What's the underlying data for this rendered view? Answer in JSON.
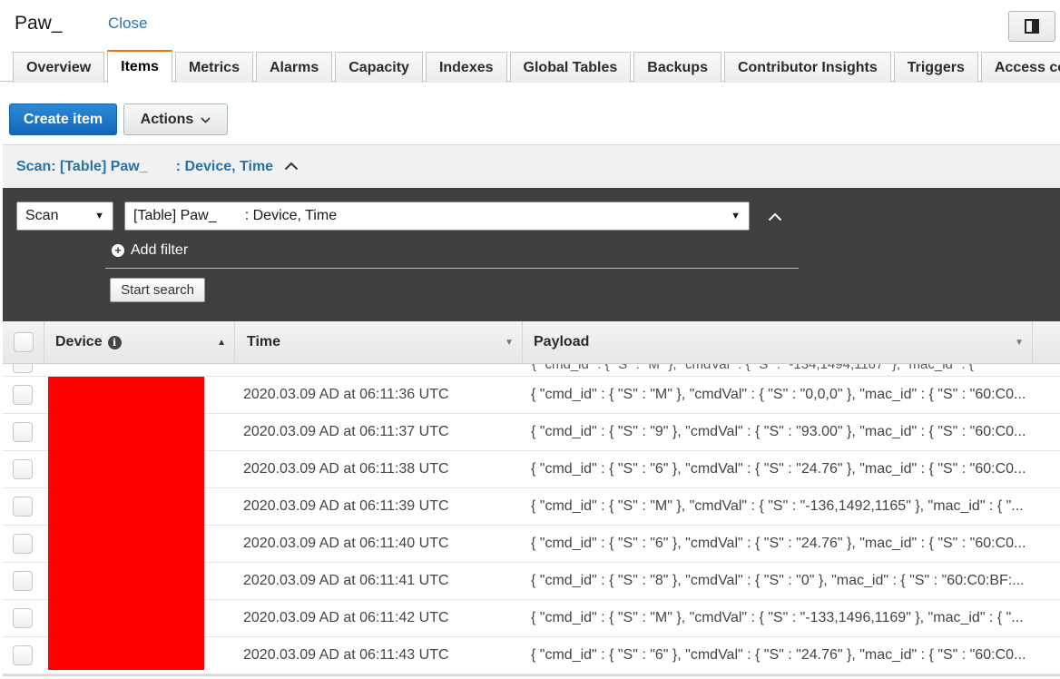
{
  "header": {
    "title": "Paw_",
    "close_label": "Close"
  },
  "tabs": [
    {
      "label": "Overview",
      "active": false
    },
    {
      "label": "Items",
      "active": true
    },
    {
      "label": "Metrics",
      "active": false
    },
    {
      "label": "Alarms",
      "active": false
    },
    {
      "label": "Capacity",
      "active": false
    },
    {
      "label": "Indexes",
      "active": false
    },
    {
      "label": "Global Tables",
      "active": false
    },
    {
      "label": "Backups",
      "active": false
    },
    {
      "label": "Contributor Insights",
      "active": false
    },
    {
      "label": "Triggers",
      "active": false
    },
    {
      "label": "Access contro",
      "active": false
    }
  ],
  "toolbar": {
    "create_item_label": "Create item",
    "actions_label": "Actions"
  },
  "scan": {
    "header_label": "Scan: [Table] Paw_       : Device, Time",
    "mode_value": "Scan",
    "table_value": "[Table] Paw_       : Device, Time",
    "add_filter_label": "Add filter",
    "start_search_label": "Start search"
  },
  "table": {
    "columns": [
      "Device",
      "Time",
      "Payload"
    ],
    "partial_row_fragment": "{ \"cmd_id\" : { \"S\" : \"M\" }, \"cmdVal\" : { \"S\" : \"-134,1494,1167\" }, \"mac_id\" : {",
    "rows": [
      {
        "time": "2020.03.09 AD at 06:11:36 UTC",
        "payload": "{ \"cmd_id\" : { \"S\" : \"M\" }, \"cmdVal\" : { \"S\" : \"0,0,0\" }, \"mac_id\" : { \"S\" : \"60:C0..."
      },
      {
        "time": "2020.03.09 AD at 06:11:37 UTC",
        "payload": "{ \"cmd_id\" : { \"S\" : \"9\" }, \"cmdVal\" : { \"S\" : \"93.00\" }, \"mac_id\" : { \"S\" : \"60:C0..."
      },
      {
        "time": "2020.03.09 AD at 06:11:38 UTC",
        "payload": "{ \"cmd_id\" : { \"S\" : \"6\" }, \"cmdVal\" : { \"S\" : \"24.76\" }, \"mac_id\" : { \"S\" : \"60:C0..."
      },
      {
        "time": "2020.03.09 AD at 06:11:39 UTC",
        "payload": "{ \"cmd_id\" : { \"S\" : \"M\" }, \"cmdVal\" : { \"S\" : \"-136,1492,1165\" }, \"mac_id\" : { \"..."
      },
      {
        "time": "2020.03.09 AD at 06:11:40 UTC",
        "payload": "{ \"cmd_id\" : { \"S\" : \"6\" }, \"cmdVal\" : { \"S\" : \"24.76\" }, \"mac_id\" : { \"S\" : \"60:C0..."
      },
      {
        "time": "2020.03.09 AD at 06:11:41 UTC",
        "payload": "{ \"cmd_id\" : { \"S\" : \"8\" }, \"cmdVal\" : { \"S\" : \"0\" }, \"mac_id\" : { \"S\" : \"60:C0:BF:..."
      },
      {
        "time": "2020.03.09 AD at 06:11:42 UTC",
        "payload": "{ \"cmd_id\" : { \"S\" : \"M\" }, \"cmdVal\" : { \"S\" : \"-133,1496,1169\" }, \"mac_id\" : { \"..."
      },
      {
        "time": "2020.03.09 AD at 06:11:43 UTC",
        "payload": "{ \"cmd_id\" : { \"S\" : \"6\" }, \"cmdVal\" : { \"S\" : \"24.76\" }, \"mac_id\" : { \"S\" : \"60:C0..."
      }
    ]
  },
  "colors": {
    "primary_button": "#1466b8",
    "link": "#2872a8",
    "active_tab_accent": "#ec7211",
    "query_panel": "#404040",
    "redaction": "#ff0000"
  },
  "icons": [
    "panel-toggle-icon",
    "chevron-down-icon",
    "chevron-up-icon",
    "add-filter-icon",
    "info-icon",
    "sort-icon"
  ]
}
